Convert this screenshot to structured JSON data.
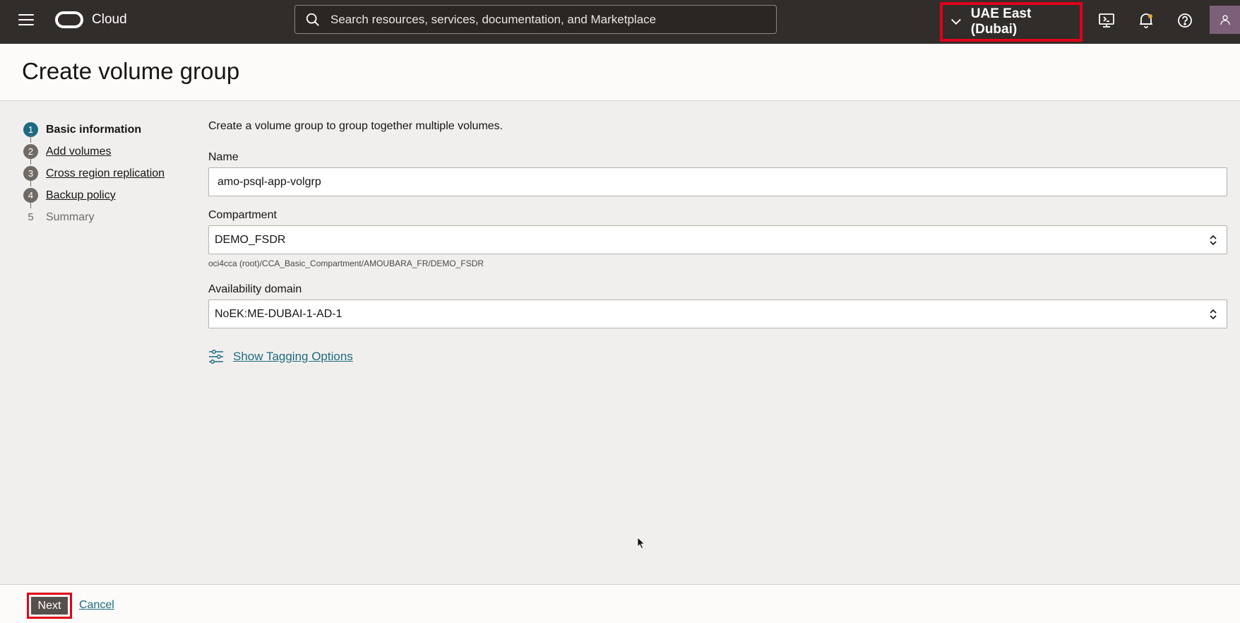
{
  "topbar": {
    "brand": "Cloud",
    "search_placeholder": "Search resources, services, documentation, and Marketplace",
    "region": "UAE East (Dubai)"
  },
  "page": {
    "title": "Create volume group"
  },
  "steps": [
    {
      "number": "1",
      "label": "Basic information",
      "state": "current"
    },
    {
      "number": "2",
      "label": "Add volumes",
      "state": "link"
    },
    {
      "number": "3",
      "label": "Cross region replication",
      "state": "link"
    },
    {
      "number": "4",
      "label": "Backup policy",
      "state": "link"
    },
    {
      "number": "5",
      "label": "Summary",
      "state": "disabled"
    }
  ],
  "form": {
    "intro": "Create a volume group to group together multiple volumes.",
    "name_label": "Name",
    "name_value": "amo-psql-app-volgrp",
    "compartment_label": "Compartment",
    "compartment_value": "DEMO_FSDR",
    "compartment_path": "oci4cca (root)/CCA_Basic_Compartment/AMOUBARA_FR/DEMO_FSDR",
    "ad_label": "Availability domain",
    "ad_value": "NoEK:ME-DUBAI-1-AD-1",
    "tagging_link": "Show Tagging Options"
  },
  "footer": {
    "next_label": "Next",
    "cancel_label": "Cancel"
  },
  "colors": {
    "accent": "#1d6b81",
    "highlight": "#e0001b",
    "topbar": "#312d2a"
  },
  "icons": [
    "menu-icon",
    "oracle-logo",
    "search-icon",
    "chevron-down-icon",
    "cloud-shell-icon",
    "bell-icon",
    "help-icon",
    "user-icon",
    "tagging-options-icon",
    "select-caret-icon",
    "mouse-cursor-icon"
  ]
}
